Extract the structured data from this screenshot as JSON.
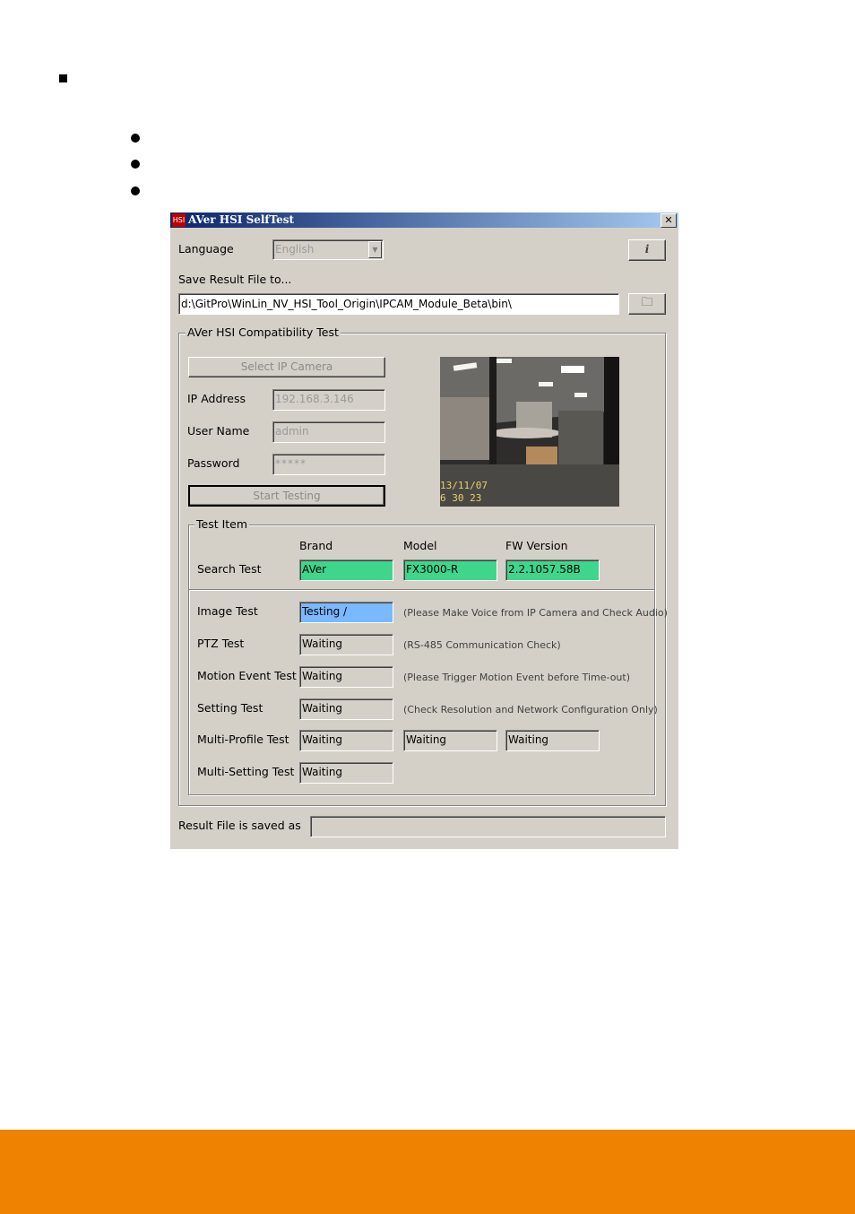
{
  "window": {
    "title": "AVer HSI SelfTest",
    "app_icon_text": "HSI",
    "close_glyph": "✕"
  },
  "language": {
    "label": "Language",
    "value": "English"
  },
  "info_button_glyph": "i",
  "save": {
    "label": "Save Result File to...",
    "path": "d:\\GitPro\\WinLin_NV_HSI_Tool_Origin\\IPCAM_Module_Beta\\bin\\",
    "browse_glyph": "🗀"
  },
  "compat_group": {
    "title": "AVer HSI Compatibility Test",
    "select_camera_button": "Select IP Camera",
    "ip_label": "IP Address",
    "ip_value": "192.168.3.146",
    "user_label": "User Name",
    "user_value": "admin",
    "password_label": "Password",
    "password_value": "*****",
    "start_button": "Start Testing",
    "camera_stamp_date": "13/11/07",
    "camera_stamp_time": "6 30 23"
  },
  "test_item": {
    "title": "Test Item",
    "headers": {
      "brand": "Brand",
      "model": "Model",
      "fw": "FW Version"
    },
    "search": {
      "label": "Search Test",
      "brand": "AVer",
      "model": "FX3000-R",
      "fw": "2.2.1057.58B"
    },
    "image": {
      "label": "Image Test",
      "status": "Testing /",
      "hint": "(Please Make Voice from IP Camera and Check Audio)"
    },
    "ptz": {
      "label": "PTZ Test",
      "status": "Waiting",
      "hint": "(RS-485 Communication Check)"
    },
    "motion": {
      "label": "Motion Event Test",
      "status": "Waiting",
      "hint": "(Please Trigger Motion Event before Time-out)"
    },
    "setting": {
      "label": "Setting Test",
      "status": "Waiting",
      "hint": "(Check Resolution and Network Configuration Only)"
    },
    "multi_profile": {
      "label": "Multi-Profile Test",
      "status1": "Waiting",
      "status2": "Waiting",
      "status3": "Waiting"
    },
    "multi_setting": {
      "label": "Multi-Setting Test",
      "status": "Waiting"
    }
  },
  "result": {
    "label": "Result File is saved as",
    "value": ""
  },
  "colors": {
    "footer": "#ef8200",
    "pass": "#3dd68c",
    "testing": "#7ab8ff"
  }
}
